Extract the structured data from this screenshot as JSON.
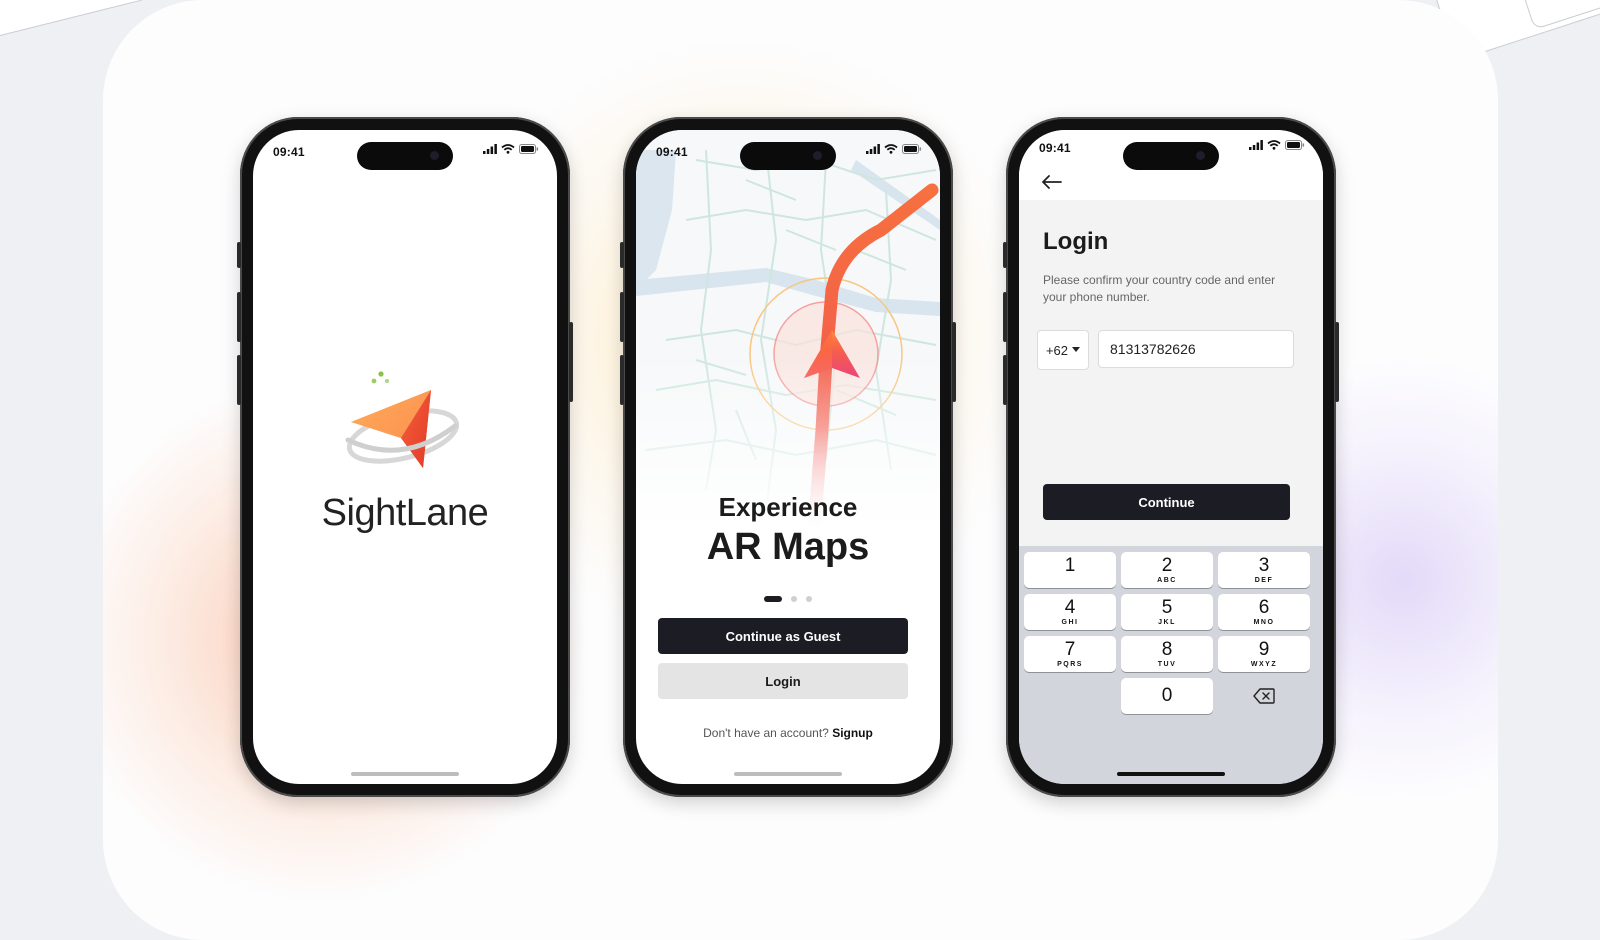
{
  "colors": {
    "accent": "#f36f3c",
    "dark_button": "#1c1c24",
    "light_button": "#e4e4e4",
    "keypad_bg": "#d2d5db"
  },
  "status_bar": {
    "time": "09:41"
  },
  "splash": {
    "brand": "SightLane",
    "logo_icon": "paper-plane-pin-icon"
  },
  "onboarding": {
    "headline_small": "Experience",
    "headline_large": "AR Maps",
    "pager_active_index": 0,
    "pager_count": 3,
    "guest_button": "Continue as Guest",
    "login_button": "Login",
    "signup_prompt": "Don't have an account?",
    "signup_link": "Signup"
  },
  "login": {
    "back_icon": "arrow-left-icon",
    "title": "Login",
    "description": "Please confirm your country code and enter your phone number.",
    "country_code": "+62",
    "phone_value": "81313782626",
    "continue_button": "Continue",
    "keypad": [
      {
        "num": "1",
        "letters": ""
      },
      {
        "num": "2",
        "letters": "ABC"
      },
      {
        "num": "3",
        "letters": "DEF"
      },
      {
        "num": "4",
        "letters": "GHI"
      },
      {
        "num": "5",
        "letters": "JKL"
      },
      {
        "num": "6",
        "letters": "MNO"
      },
      {
        "num": "7",
        "letters": "PQRS"
      },
      {
        "num": "8",
        "letters": "TUV"
      },
      {
        "num": "9",
        "letters": "WXYZ"
      },
      {
        "num": "0",
        "letters": ""
      }
    ],
    "delete_icon": "backspace-icon"
  }
}
